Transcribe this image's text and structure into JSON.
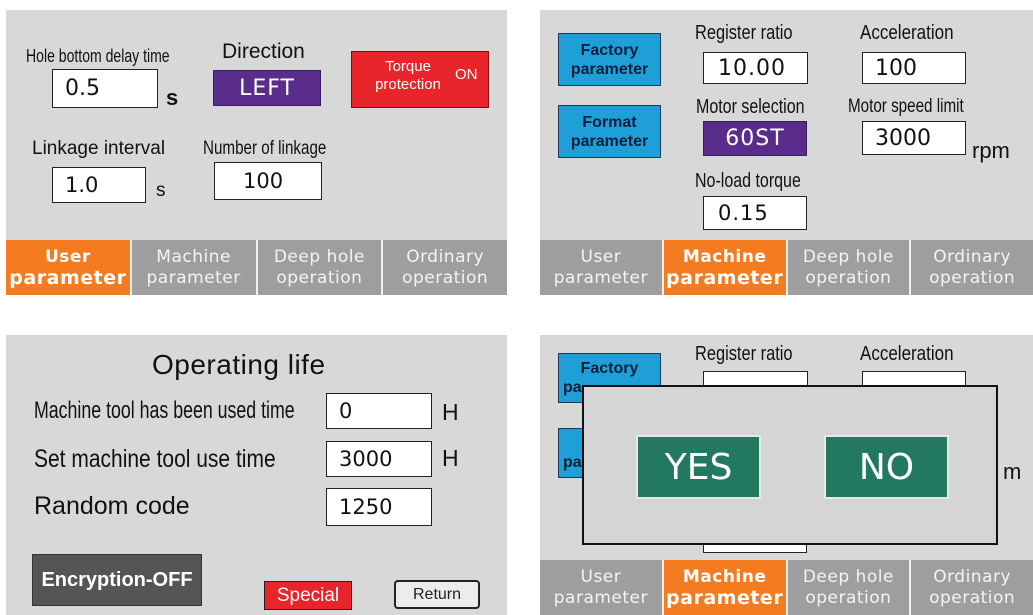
{
  "tabs": [
    {
      "line1": "User",
      "line2": "parameter"
    },
    {
      "line1": "Machine",
      "line2": "parameter"
    },
    {
      "line1": "Deep hole",
      "line2": "operation"
    },
    {
      "line1": "Ordinary",
      "line2": "operation"
    }
  ],
  "user_panel": {
    "hole_bottom_delay_label": "Hole bottom delay time",
    "hole_bottom_delay_value": "0.5",
    "hole_bottom_delay_unit": "s",
    "direction_label": "Direction",
    "direction_value": "LEFT",
    "torque_label_line1": "Torque",
    "torque_label_line2": "protection",
    "torque_state": "ON",
    "linkage_interval_label": "Linkage interval",
    "linkage_interval_value": "1.0",
    "linkage_interval_unit": "s",
    "number_of_linkage_label": "Number of linkage",
    "number_of_linkage_value": "100",
    "active_tab": 0
  },
  "machine_panel": {
    "factory_button_line1": "Factory",
    "factory_button_line2": "parameter",
    "format_button_line1": "Format",
    "format_button_line2": "parameter",
    "register_ratio_label": "Register ratio",
    "register_ratio_value": "10.00",
    "acceleration_label": "Acceleration",
    "acceleration_value": "100",
    "motor_selection_label": "Motor selection",
    "motor_selection_value": "60ST",
    "motor_speed_limit_label": "Motor speed limit",
    "motor_speed_limit_value": "3000",
    "motor_speed_limit_unit": "rpm",
    "no_load_torque_label": "No-load torque",
    "no_load_torque_value": "0.15",
    "active_tab": 1
  },
  "life_panel": {
    "title": "Operating life",
    "used_time_label": "Machine tool has been used time",
    "used_time_value": "0",
    "used_time_unit": "H",
    "set_time_label": "Set machine tool use time",
    "set_time_value": "3000",
    "set_time_unit": "H",
    "random_code_label": "Random code",
    "random_code_value": "1250",
    "encryption_button": "Encryption-OFF",
    "special_button": "Special",
    "return_button": "Return"
  },
  "dialog_panel": {
    "factory_visible": "Factory",
    "factory_partial": "pa",
    "format_partial": "pa",
    "register_ratio_label": "Register ratio",
    "acceleration_label": "Acceleration",
    "unit_partial": "m",
    "yes_button": "YES",
    "no_button": "NO",
    "active_tab": 1
  },
  "colors": {
    "panel_bg": "#d8d8d8",
    "tab_inactive": "#9e9e9e",
    "tab_active": "#f47b20",
    "purple_value": "#5a2d8c",
    "torque_red": "#e8252a",
    "blue_button": "#1f9fd8",
    "dialog_green": "#23795f",
    "encryption_dark": "#555555"
  }
}
